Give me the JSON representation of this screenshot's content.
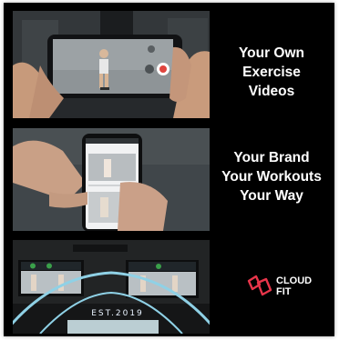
{
  "taglines": [
    {
      "lines": [
        "Your Own",
        "Exercise",
        "Videos"
      ]
    },
    {
      "lines": [
        "Your Brand",
        "Your Workouts",
        "Your Way"
      ]
    }
  ],
  "brand": {
    "line1": "CLOUD",
    "line2": "FIT"
  },
  "gym_wall_text": "EST.2019",
  "colors": {
    "background": "#000000",
    "text": "#ffffff",
    "brand_red": "#e8354a",
    "record_red": "#e0453e"
  },
  "icons": [
    "cloudfit-logo-icon",
    "record-icon"
  ]
}
